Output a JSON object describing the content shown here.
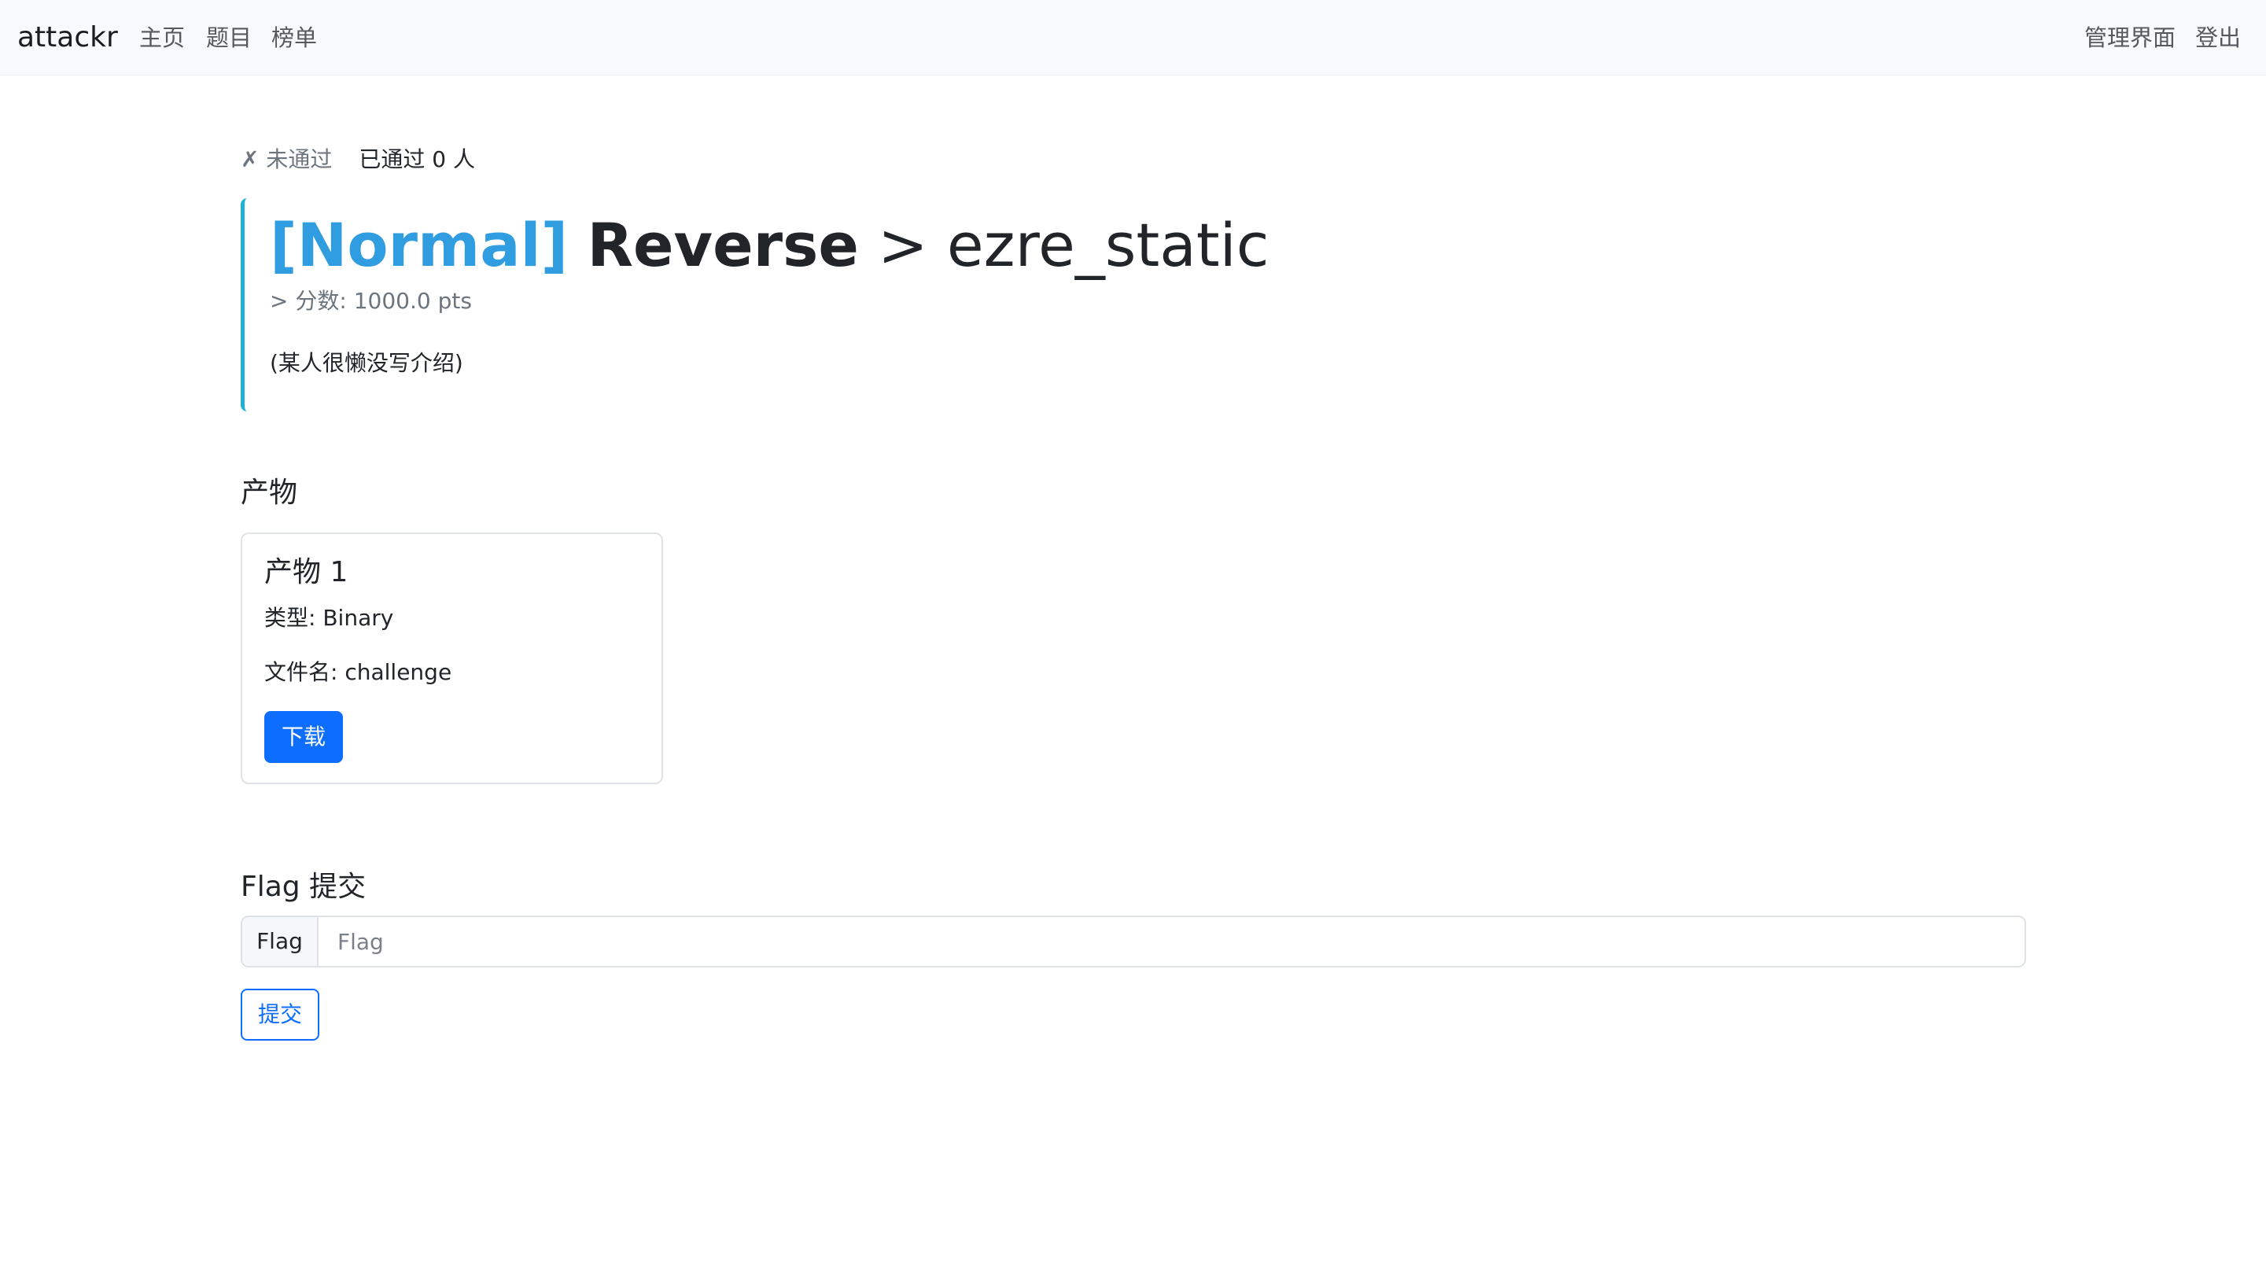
{
  "navbar": {
    "brand": "attackr",
    "links": [
      "主页",
      "题目",
      "榜单"
    ],
    "right_links": [
      "管理界面",
      "登出"
    ]
  },
  "status": {
    "fail_label": "✗ 未通过",
    "passed_label": "已通过 0 人"
  },
  "challenge": {
    "level": "[Normal]",
    "category": "Reverse",
    "separator": ">",
    "name": "ezre_static",
    "score": "> 分数: 1000.0 pts",
    "description": "(某人很懒没写介绍)"
  },
  "artifacts": {
    "heading": "产物",
    "items": [
      {
        "title": "产物 1",
        "type_line": "类型: Binary",
        "filename_line": "文件名: challenge",
        "download_label": "下载"
      }
    ]
  },
  "flag_submit": {
    "heading": "Flag 提交",
    "prefix": "Flag",
    "placeholder": "Flag",
    "value": "",
    "submit_label": "提交"
  },
  "colors": {
    "accent": "#0d6efd",
    "level": "#2f9ddf",
    "block_border": "#1eb3d6",
    "navbar_bg": "#f8f9fa"
  }
}
